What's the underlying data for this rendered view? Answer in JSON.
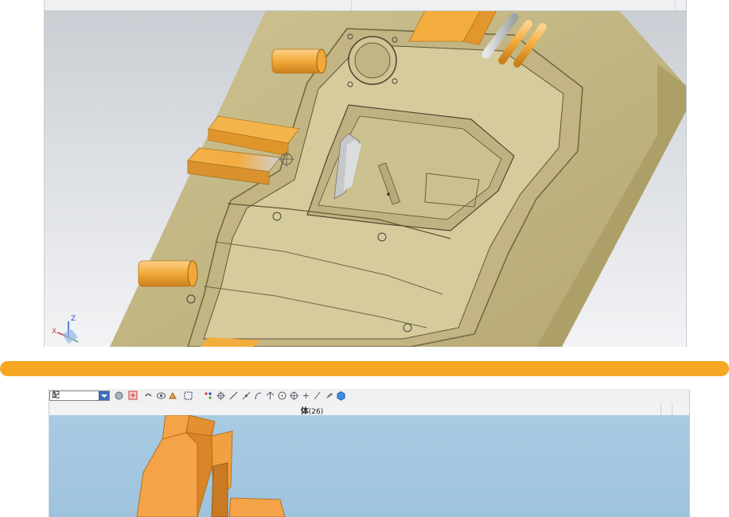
{
  "top_viewport": {
    "axis_labels": {
      "x": "X",
      "z": "Z"
    },
    "colors": {
      "background_top": "#cdd1d6",
      "background_bottom": "#f2f3f5",
      "mold_plate": "#c8bd8a",
      "accent_parts": "#f4b34a",
      "steel_parts": "#c4c6c8"
    }
  },
  "divider": {
    "color": "#f6a723"
  },
  "bottom_window": {
    "toolbar": {
      "select_value": "配",
      "icons": [
        "filter-icon",
        "select-all-icon",
        "undo-icon",
        "view-icon",
        "snap-icon",
        "box-select-icon",
        "point-icon",
        "center-icon",
        "line-icon",
        "tangent-icon",
        "arc-icon",
        "perpendicular-icon",
        "circle-icon",
        "target-icon",
        "plus-icon",
        "slash-icon",
        "brush-icon",
        "cube-icon"
      ]
    },
    "status": {
      "body_label": "体",
      "body_count": "(26)"
    },
    "colors": {
      "background": "#9ec4de",
      "part": "#f6a34a"
    }
  }
}
